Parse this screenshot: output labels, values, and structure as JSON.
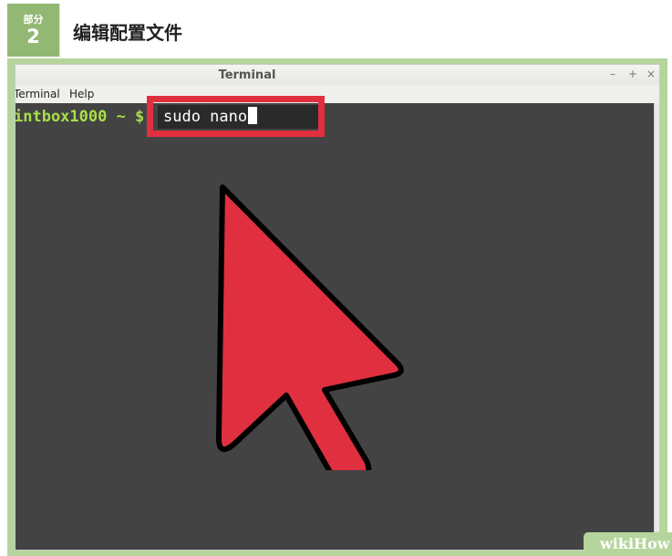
{
  "header": {
    "part_label": "部分",
    "part_number": "2",
    "title": "编辑配置文件"
  },
  "window": {
    "title": "Terminal",
    "controls": [
      "–",
      "+",
      "×"
    ],
    "menu": [
      "Terminal",
      "Help"
    ]
  },
  "terminal": {
    "prompt": "intbox1000 ~ $",
    "command": "sudo nano"
  },
  "annotation": {
    "color": "#e0303f",
    "icon": "arrow-pointer-icon"
  },
  "watermark": {
    "text": "wikiHow"
  }
}
